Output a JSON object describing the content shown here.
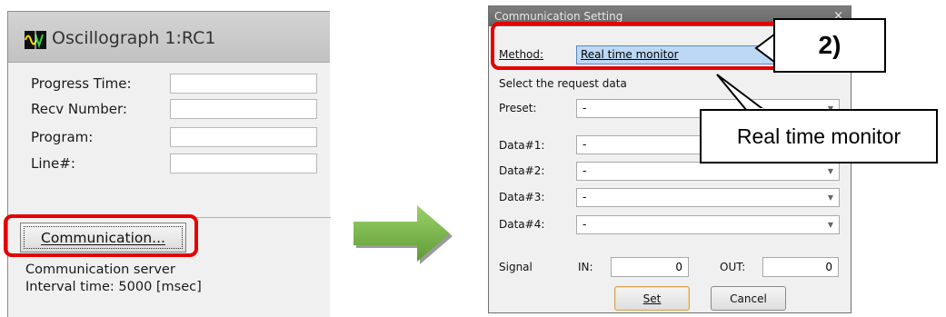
{
  "oscillograph": {
    "title": "Oscillograph 1:RC1",
    "fields": [
      {
        "label": "Progress Time:",
        "value": ""
      },
      {
        "label": "Recv Number:",
        "value": ""
      },
      {
        "label": "Program:",
        "value": ""
      },
      {
        "label": "Line#:",
        "value": ""
      }
    ],
    "communication_button": "Communication...",
    "status_server": "Communication server",
    "status_interval": "Interval time: 5000 [msec]"
  },
  "dialog": {
    "title": "Communication Setting",
    "close": "×",
    "method_label": "Method:",
    "method_value": "Real time monitor",
    "request_heading": "Select the request data",
    "preset_label": "Preset:",
    "preset_value": "-",
    "data_rows": [
      {
        "label": "Data#1:",
        "value": "-"
      },
      {
        "label": "Data#2:",
        "value": "-"
      },
      {
        "label": "Data#3:",
        "value": "-"
      },
      {
        "label": "Data#4:",
        "value": "-"
      }
    ],
    "signal_label": "Signal",
    "in_label": "IN:",
    "in_value": "0",
    "out_label": "OUT:",
    "out_value": "0",
    "set_button": "Set",
    "cancel_button": "Cancel"
  },
  "callouts": {
    "step": "2)",
    "method_note": "Real time monitor"
  },
  "colors": {
    "highlight_red": "#e40000",
    "arrow_green": "#7ab648"
  }
}
